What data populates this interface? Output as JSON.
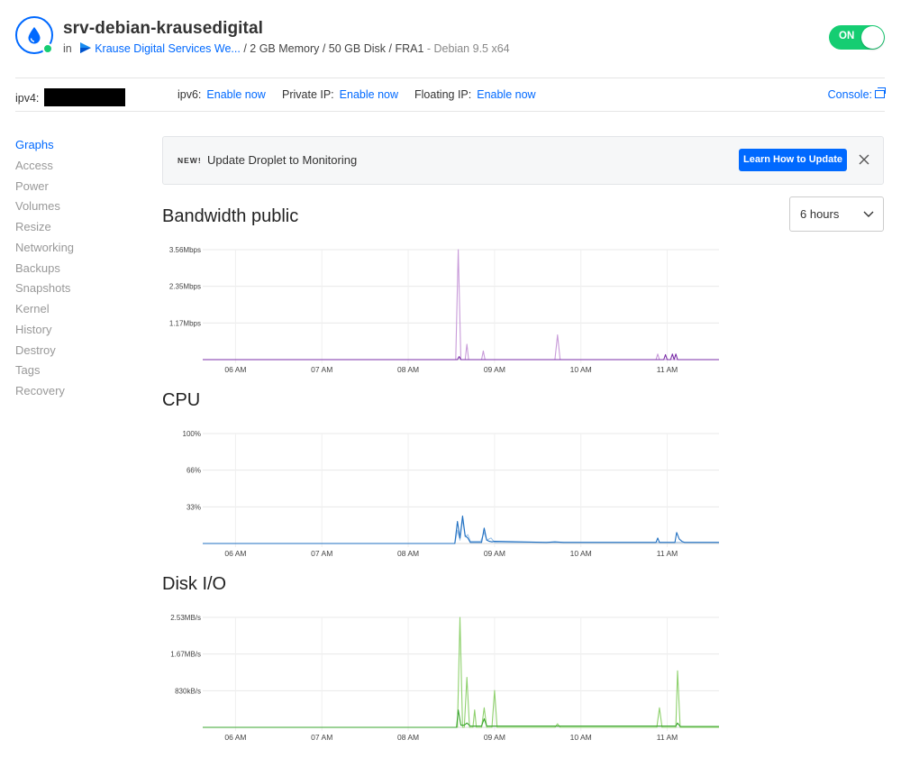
{
  "header": {
    "title": "srv-debian-krausedigital",
    "in_label": "in",
    "team": "Krause Digital Services We...",
    "specs": "/ 2 GB Memory / 50 GB Disk / FRA1",
    "os": "- Debian 9.5 x64",
    "power_toggle": "ON",
    "colors": {
      "accent": "#0069ff",
      "status": "#15cd72"
    }
  },
  "infobar": {
    "ipv4_label": "ipv4:",
    "ipv6_label": "ipv6:",
    "ipv6_action": "Enable now",
    "private_ip_label": "Private IP:",
    "private_ip_action": "Enable now",
    "floating_ip_label": "Floating IP:",
    "floating_ip_action": "Enable now",
    "console_label": "Console:"
  },
  "sidebar": {
    "items": [
      {
        "label": "Graphs",
        "active": true
      },
      {
        "label": "Access"
      },
      {
        "label": "Power"
      },
      {
        "label": "Volumes"
      },
      {
        "label": "Resize"
      },
      {
        "label": "Networking"
      },
      {
        "label": "Backups"
      },
      {
        "label": "Snapshots"
      },
      {
        "label": "Kernel"
      },
      {
        "label": "History"
      },
      {
        "label": "Destroy"
      },
      {
        "label": "Tags"
      },
      {
        "label": "Recovery"
      }
    ]
  },
  "banner": {
    "badge": "NEW!",
    "message": "Update Droplet to Monitoring",
    "button": "Learn How to Update"
  },
  "range_select": {
    "value": "6 hours"
  },
  "chart_data": [
    {
      "type": "line",
      "title": "Bandwidth public",
      "x_ticks": [
        "06 AM",
        "07 AM",
        "08 AM",
        "09 AM",
        "10 AM",
        "11 AM"
      ],
      "y_ticks": [
        "1.17Mbps",
        "2.35Mbps",
        "3.56Mbps"
      ],
      "ylim": [
        0,
        3.56
      ],
      "grid": true,
      "series": [
        {
          "color": "#c89bd9",
          "points": [
            [
              8.5,
              0
            ],
            [
              8.55,
              0
            ],
            [
              8.58,
              3.56
            ],
            [
              8.61,
              0
            ],
            [
              8.66,
              0
            ],
            [
              8.68,
              0.5
            ],
            [
              8.7,
              0
            ],
            [
              8.85,
              0
            ],
            [
              8.87,
              0.28
            ],
            [
              8.89,
              0
            ],
            [
              9.7,
              0
            ],
            [
              9.73,
              0.8
            ],
            [
              9.76,
              0
            ],
            [
              10.87,
              0
            ],
            [
              10.89,
              0.18
            ],
            [
              10.91,
              0
            ],
            [
              11.6,
              0
            ]
          ]
        },
        {
          "color": "#7b2fa8",
          "points": [
            [
              8.5,
              0
            ],
            [
              8.57,
              0
            ],
            [
              8.59,
              0.1
            ],
            [
              8.61,
              0
            ],
            [
              10.96,
              0
            ],
            [
              10.98,
              0.16
            ],
            [
              11.0,
              0
            ],
            [
              11.04,
              0
            ],
            [
              11.06,
              0.18
            ],
            [
              11.08,
              0
            ],
            [
              11.1,
              0.18
            ],
            [
              11.12,
              0
            ],
            [
              11.6,
              0
            ]
          ]
        }
      ]
    },
    {
      "type": "line",
      "title": "CPU",
      "x_ticks": [
        "06 AM",
        "07 AM",
        "08 AM",
        "09 AM",
        "10 AM",
        "11 AM"
      ],
      "y_ticks": [
        "33%",
        "66%",
        "100%"
      ],
      "ylim": [
        0,
        100
      ],
      "grid": true,
      "series": [
        {
          "color": "#9fc3e8",
          "points": [
            [
              8.5,
              0
            ],
            [
              8.54,
              0
            ],
            [
              8.57,
              12
            ],
            [
              8.6,
              3
            ],
            [
              8.63,
              22
            ],
            [
              8.66,
              6
            ],
            [
              8.69,
              8
            ],
            [
              8.72,
              2
            ],
            [
              8.84,
              2
            ],
            [
              8.88,
              10
            ],
            [
              8.91,
              3
            ],
            [
              8.96,
              5
            ],
            [
              9.0,
              1
            ],
            [
              11.6,
              1
            ]
          ]
        },
        {
          "color": "#1f6fc1",
          "points": [
            [
              8.5,
              0
            ],
            [
              8.54,
              0
            ],
            [
              8.57,
              20
            ],
            [
              8.6,
              5
            ],
            [
              8.63,
              25
            ],
            [
              8.66,
              7
            ],
            [
              8.69,
              5
            ],
            [
              8.72,
              1
            ],
            [
              8.85,
              1
            ],
            [
              8.88,
              14
            ],
            [
              8.91,
              3
            ],
            [
              8.94,
              2
            ],
            [
              8.97,
              1.5
            ],
            [
              9.0,
              2
            ],
            [
              9.6,
              1
            ],
            [
              9.7,
              1.5
            ],
            [
              9.8,
              1
            ],
            [
              10.5,
              1
            ],
            [
              10.87,
              1
            ],
            [
              10.89,
              5
            ],
            [
              10.91,
              1
            ],
            [
              11.09,
              1
            ],
            [
              11.11,
              10
            ],
            [
              11.14,
              4
            ],
            [
              11.17,
              2
            ],
            [
              11.2,
              1
            ],
            [
              11.6,
              1
            ]
          ]
        }
      ]
    },
    {
      "type": "line",
      "title": "Disk I/O",
      "x_ticks": [
        "06 AM",
        "07 AM",
        "08 AM",
        "09 AM",
        "10 AM",
        "11 AM"
      ],
      "y_ticks": [
        "830kB/s",
        "1.67MB/s",
        "2.53MB/s"
      ],
      "ylim": [
        0,
        2.53
      ],
      "grid": true,
      "series": [
        {
          "color": "#8fd16e",
          "points": [
            [
              8.5,
              0
            ],
            [
              8.57,
              0
            ],
            [
              8.6,
              2.53
            ],
            [
              8.63,
              0
            ],
            [
              8.65,
              0
            ],
            [
              8.68,
              1.15
            ],
            [
              8.71,
              0
            ],
            [
              8.75,
              0
            ],
            [
              8.77,
              0.4
            ],
            [
              8.79,
              0
            ],
            [
              8.85,
              0
            ],
            [
              8.88,
              0.45
            ],
            [
              8.91,
              0
            ],
            [
              8.97,
              0
            ],
            [
              9.0,
              0.85
            ],
            [
              9.03,
              0
            ],
            [
              9.7,
              0
            ],
            [
              9.73,
              0.08
            ],
            [
              9.76,
              0
            ],
            [
              10.88,
              0
            ],
            [
              10.91,
              0.45
            ],
            [
              10.94,
              0
            ],
            [
              11.1,
              0
            ],
            [
              11.12,
              1.3
            ],
            [
              11.15,
              0
            ],
            [
              11.6,
              0
            ]
          ]
        },
        {
          "color": "#3aa52e",
          "points": [
            [
              8.5,
              0
            ],
            [
              8.56,
              0
            ],
            [
              8.58,
              0.4
            ],
            [
              8.61,
              0.05
            ],
            [
              8.65,
              0.05
            ],
            [
              8.68,
              0.1
            ],
            [
              8.72,
              0.03
            ],
            [
              8.85,
              0.03
            ],
            [
              8.88,
              0.2
            ],
            [
              8.91,
              0.03
            ],
            [
              9.0,
              0.03
            ],
            [
              11.1,
              0.03
            ],
            [
              11.12,
              0.1
            ],
            [
              11.15,
              0.02
            ],
            [
              11.6,
              0.02
            ]
          ]
        }
      ]
    }
  ]
}
